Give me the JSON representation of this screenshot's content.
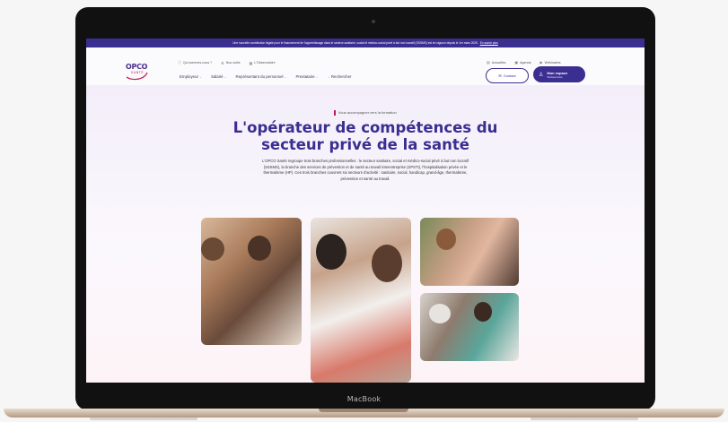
{
  "device": {
    "bezel_label": "MacBook"
  },
  "site": {
    "announcement": {
      "text": "Une nouvelle contribution légale pour le financement de l'apprentissage dans le secteur sanitaire, social et médico-social privé à but non lucratif (SSSMS) est en vigueur depuis le 1er mars 2025.",
      "link_label": "En savoir plus"
    },
    "logo": {
      "line1": "OPCO",
      "line2": "SANTÉ"
    },
    "utility_nav": [
      {
        "label": "Qui sommes-nous ?",
        "icon": "info-icon"
      },
      {
        "label": "Nos outils",
        "icon": "tool-icon"
      },
      {
        "label": "L'Observatoire",
        "icon": "chart-icon"
      }
    ],
    "utility_right": [
      {
        "label": "Actualités",
        "icon": "news-icon"
      },
      {
        "label": "Agenda",
        "icon": "calendar-icon"
      },
      {
        "label": "Webinaires",
        "icon": "video-icon"
      }
    ],
    "main_nav": [
      "Employeur",
      "Salarié",
      "Représentant du personnel",
      "Prestataire"
    ],
    "search_label": "Rechercher",
    "contact_label": "Contact",
    "account": {
      "title": "Mon espace",
      "subtitle": "Webservices"
    },
    "hero": {
      "eyebrow": "Vous accompagner vers la formation",
      "title_line1": "L'opérateur de compétences du",
      "title_line2": "secteur privé de la santé",
      "description": "L'OPCO Santé regroupe trois branches professionnelles : le secteur sanitaire, social et médico-social privé à but non lucratif (SSSMS), la branche des services de prévention et de santé au travail interentreprise (SPSTI), l'hospitalisation privée et le thermalisme (HP). Ces trois branches couvrent six secteurs d'activité : sanitaire, social, handicap, grand-âge, thermalisme, prévention et santé au travail."
    },
    "colors": {
      "brand": "#3a2e91",
      "accent": "#c2185b"
    }
  }
}
